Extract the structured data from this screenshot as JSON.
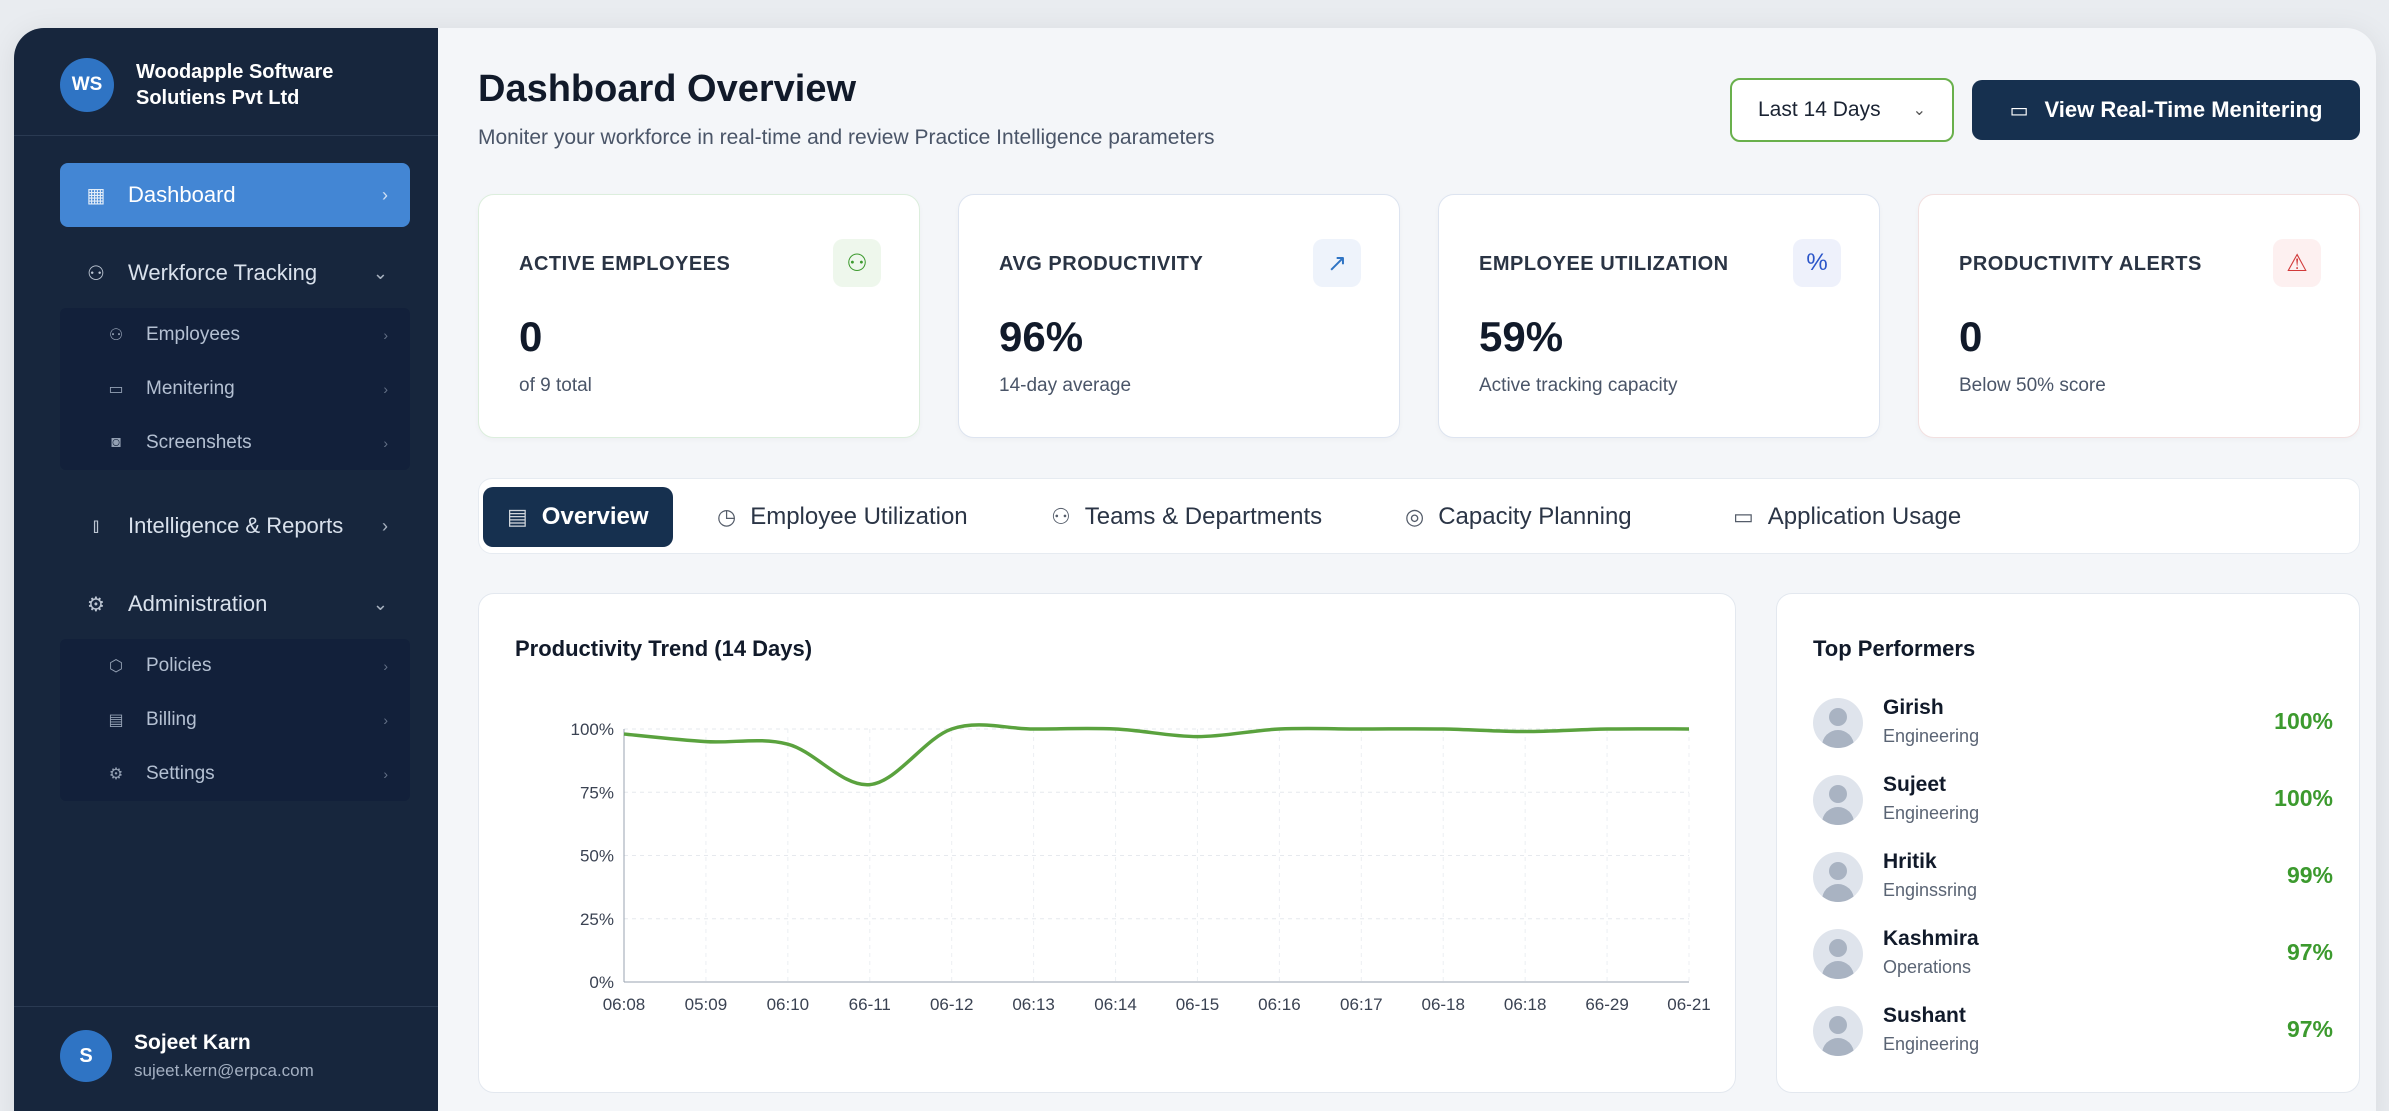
{
  "brand": {
    "initials": "WS",
    "name": "Woodapple Software Solutiens Pvt Ltd"
  },
  "sidebar": {
    "dashboard": "Dashboard",
    "workforce": "Werkforce Tracking",
    "workforce_items": [
      "Employees",
      "Menitering",
      "Screenshets"
    ],
    "intelligence": "Intelligence & Reports",
    "administration": "Administration",
    "admin_items": [
      "Policies",
      "Billing",
      "Settings"
    ]
  },
  "user": {
    "initials": "S",
    "name": "Sojeet Karn",
    "email": "sujeet.kern@erpca.com"
  },
  "header": {
    "title": "Dashboard Overview",
    "subtitle": "Moniter your workforce in real-time and review Practice Intelligence parameters",
    "range": "Last 14 Days",
    "realtime_button": "View Real-Time Menitering"
  },
  "kpis": [
    {
      "label": "ACTIVE EMPLOYEES",
      "value": "0",
      "sub": "of 9 total",
      "icon": "users-icon",
      "color": "#3c9a2e"
    },
    {
      "label": "AVG PRODUCTIVITY",
      "value": "96%",
      "sub": "14-day average",
      "icon": "trending-up-icon",
      "color": "#2f74c4"
    },
    {
      "label": "EMPLOYEE UTILIZATION",
      "value": "59%",
      "sub": "Active tracking capacity",
      "icon": "percent-icon",
      "color": "#2a55c9"
    },
    {
      "label": "PRODUCTIVITY ALERTS",
      "value": "0",
      "sub": "Below 50% score",
      "icon": "warning-icon",
      "color": "#d23a3a"
    }
  ],
  "tabs": [
    "Overview",
    "Employee Utilization",
    "Teams & Departments",
    "Capacity Planning",
    "Application Usage"
  ],
  "trend": {
    "title": "Productivity Trend (14 Days)"
  },
  "top_performers": {
    "title": "Top Performers",
    "items": [
      {
        "name": "Girish",
        "dept": "Engineering",
        "score": "100%"
      },
      {
        "name": "Sujeet",
        "dept": "Engineering",
        "score": "100%"
      },
      {
        "name": "Hritik",
        "dept": "Enginssring",
        "score": "99%"
      },
      {
        "name": "Kashmira",
        "dept": "Operations",
        "score": "97%"
      },
      {
        "name": "Sushant",
        "dept": "Engineering",
        "score": "97%"
      }
    ]
  },
  "chart_data": {
    "type": "line",
    "title": "Productivity Trend (14 Days)",
    "categories": [
      "06:08",
      "05:09",
      "06:10",
      "66-11",
      "06-12",
      "06:13",
      "06:14",
      "06-15",
      "06:16",
      "06:17",
      "06-18",
      "06:18",
      "66-29",
      "06-21"
    ],
    "series": [
      {
        "values": [
          98,
          95,
          94,
          78,
          100,
          100,
          100,
          97,
          100,
          100,
          100,
          99,
          100,
          100
        ]
      }
    ],
    "yticks": [
      "100%",
      "75%",
      "50%",
      "25%",
      "0%"
    ],
    "ylim": [
      0,
      100
    ],
    "grid": true,
    "color": "#5aa23e"
  }
}
